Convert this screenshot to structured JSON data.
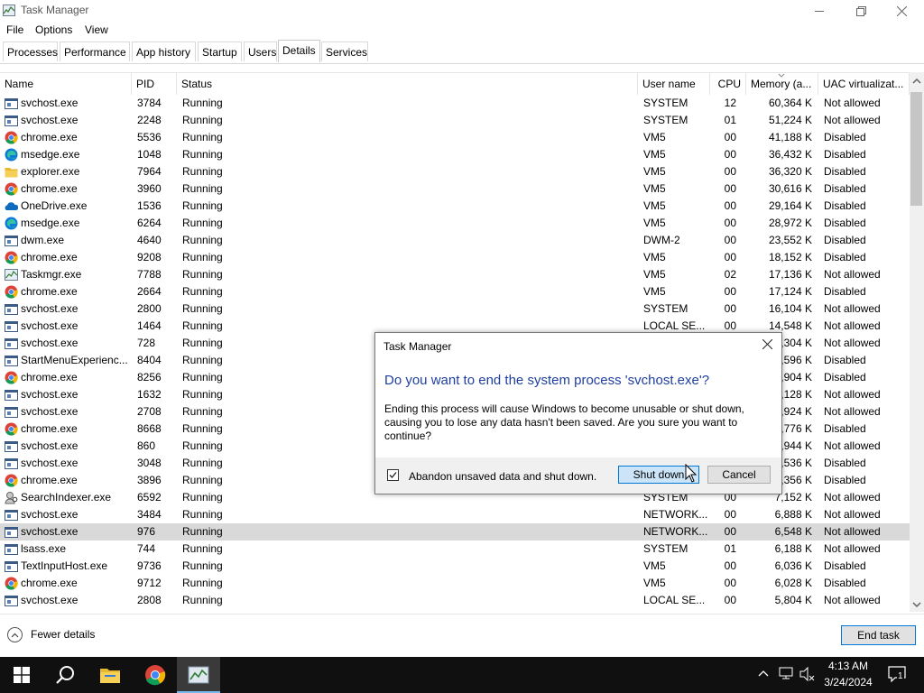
{
  "window": {
    "title": "Task Manager"
  },
  "menu": [
    "File",
    "Options",
    "View"
  ],
  "tabs": [
    "Processes",
    "Performance",
    "App history",
    "Startup",
    "Users",
    "Details",
    "Services"
  ],
  "active_tab": "Details",
  "columns": [
    "Name",
    "PID",
    "Status",
    "User name",
    "CPU",
    "Memory (a...",
    "UAC virtualizat..."
  ],
  "rows": [
    {
      "icon": "service-icon",
      "name": "svchost.exe",
      "pid": "3784",
      "status": "Running",
      "user": "SYSTEM",
      "cpu": "12",
      "mem": "60,364 K",
      "uac": "Not allowed"
    },
    {
      "icon": "service-icon",
      "name": "svchost.exe",
      "pid": "2248",
      "status": "Running",
      "user": "SYSTEM",
      "cpu": "01",
      "mem": "51,224 K",
      "uac": "Not allowed"
    },
    {
      "icon": "chrome-icon",
      "name": "chrome.exe",
      "pid": "5536",
      "status": "Running",
      "user": "VM5",
      "cpu": "00",
      "mem": "41,188 K",
      "uac": "Disabled"
    },
    {
      "icon": "edge-icon",
      "name": "msedge.exe",
      "pid": "1048",
      "status": "Running",
      "user": "VM5",
      "cpu": "00",
      "mem": "36,432 K",
      "uac": "Disabled"
    },
    {
      "icon": "explorer-icon",
      "name": "explorer.exe",
      "pid": "7964",
      "status": "Running",
      "user": "VM5",
      "cpu": "00",
      "mem": "36,320 K",
      "uac": "Disabled"
    },
    {
      "icon": "chrome-icon",
      "name": "chrome.exe",
      "pid": "3960",
      "status": "Running",
      "user": "VM5",
      "cpu": "00",
      "mem": "30,616 K",
      "uac": "Disabled"
    },
    {
      "icon": "onedrive-icon",
      "name": "OneDrive.exe",
      "pid": "1536",
      "status": "Running",
      "user": "VM5",
      "cpu": "00",
      "mem": "29,164 K",
      "uac": "Disabled"
    },
    {
      "icon": "edge-icon",
      "name": "msedge.exe",
      "pid": "6264",
      "status": "Running",
      "user": "VM5",
      "cpu": "00",
      "mem": "28,972 K",
      "uac": "Disabled"
    },
    {
      "icon": "service-icon",
      "name": "dwm.exe",
      "pid": "4640",
      "status": "Running",
      "user": "DWM-2",
      "cpu": "00",
      "mem": "23,552 K",
      "uac": "Disabled"
    },
    {
      "icon": "chrome-icon",
      "name": "chrome.exe",
      "pid": "9208",
      "status": "Running",
      "user": "VM5",
      "cpu": "00",
      "mem": "18,152 K",
      "uac": "Disabled"
    },
    {
      "icon": "taskmgr-icon",
      "name": "Taskmgr.exe",
      "pid": "7788",
      "status": "Running",
      "user": "VM5",
      "cpu": "02",
      "mem": "17,136 K",
      "uac": "Not allowed"
    },
    {
      "icon": "chrome-icon",
      "name": "chrome.exe",
      "pid": "2664",
      "status": "Running",
      "user": "VM5",
      "cpu": "00",
      "mem": "17,124 K",
      "uac": "Disabled"
    },
    {
      "icon": "service-icon",
      "name": "svchost.exe",
      "pid": "2800",
      "status": "Running",
      "user": "SYSTEM",
      "cpu": "00",
      "mem": "16,104 K",
      "uac": "Not allowed"
    },
    {
      "icon": "service-icon",
      "name": "svchost.exe",
      "pid": "1464",
      "status": "Running",
      "user": "LOCAL SE...",
      "cpu": "00",
      "mem": "14,548 K",
      "uac": "Not allowed"
    },
    {
      "icon": "service-icon",
      "name": "svchost.exe",
      "pid": "728",
      "status": "Running",
      "user": "",
      "cpu": "",
      "mem": "4,304 K",
      "uac": "Not allowed"
    },
    {
      "icon": "service-icon",
      "name": "StartMenuExperienc...",
      "pid": "8404",
      "status": "Running",
      "user": "",
      "cpu": "",
      "mem": "3,596 K",
      "uac": "Disabled"
    },
    {
      "icon": "chrome-icon",
      "name": "chrome.exe",
      "pid": "8256",
      "status": "Running",
      "user": "",
      "cpu": "",
      "mem": "0,904 K",
      "uac": "Disabled"
    },
    {
      "icon": "service-icon",
      "name": "svchost.exe",
      "pid": "1632",
      "status": "Running",
      "user": "",
      "cpu": "",
      "mem": "0,128 K",
      "uac": "Not allowed"
    },
    {
      "icon": "service-icon",
      "name": "svchost.exe",
      "pid": "2708",
      "status": "Running",
      "user": "",
      "cpu": "",
      "mem": "9,924 K",
      "uac": "Not allowed"
    },
    {
      "icon": "chrome-icon",
      "name": "chrome.exe",
      "pid": "8668",
      "status": "Running",
      "user": "",
      "cpu": "",
      "mem": "7,776 K",
      "uac": "Disabled"
    },
    {
      "icon": "service-icon",
      "name": "svchost.exe",
      "pid": "860",
      "status": "Running",
      "user": "",
      "cpu": "",
      "mem": "7,944 K",
      "uac": "Not allowed"
    },
    {
      "icon": "service-icon",
      "name": "svchost.exe",
      "pid": "3048",
      "status": "Running",
      "user": "",
      "cpu": "",
      "mem": "7,536 K",
      "uac": "Disabled"
    },
    {
      "icon": "chrome-icon",
      "name": "chrome.exe",
      "pid": "3896",
      "status": "Running",
      "user": "",
      "cpu": "",
      "mem": "7,356 K",
      "uac": "Disabled"
    },
    {
      "icon": "search-indexer-icon",
      "name": "SearchIndexer.exe",
      "pid": "6592",
      "status": "Running",
      "user": "SYSTEM",
      "cpu": "00",
      "mem": "7,152 K",
      "uac": "Not allowed"
    },
    {
      "icon": "service-icon",
      "name": "svchost.exe",
      "pid": "3484",
      "status": "Running",
      "user": "NETWORK...",
      "cpu": "00",
      "mem": "6,888 K",
      "uac": "Not allowed"
    },
    {
      "icon": "service-icon",
      "name": "svchost.exe",
      "pid": "976",
      "status": "Running",
      "user": "NETWORK...",
      "cpu": "00",
      "mem": "6,548 K",
      "uac": "Not allowed",
      "selected": true
    },
    {
      "icon": "service-icon",
      "name": "lsass.exe",
      "pid": "744",
      "status": "Running",
      "user": "SYSTEM",
      "cpu": "01",
      "mem": "6,188 K",
      "uac": "Not allowed"
    },
    {
      "icon": "service-icon",
      "name": "TextInputHost.exe",
      "pid": "9736",
      "status": "Running",
      "user": "VM5",
      "cpu": "00",
      "mem": "6,036 K",
      "uac": "Disabled"
    },
    {
      "icon": "chrome-icon",
      "name": "chrome.exe",
      "pid": "9712",
      "status": "Running",
      "user": "VM5",
      "cpu": "00",
      "mem": "6,028 K",
      "uac": "Disabled"
    },
    {
      "icon": "service-icon",
      "name": "svchost.exe",
      "pid": "2808",
      "status": "Running",
      "user": "LOCAL SE...",
      "cpu": "00",
      "mem": "5,804 K",
      "uac": "Not allowed"
    }
  ],
  "footer": {
    "fewer_details": "Fewer details",
    "end_task": "End task"
  },
  "dialog": {
    "title": "Task Manager",
    "heading": "Do you want to end the system process 'svchost.exe'?",
    "body": "Ending this process will cause Windows to become unusable or shut down, causing you to lose any data hasn't been saved. Are you sure you want to continue?",
    "checkbox_label": "Abandon unsaved data and shut down.",
    "checkbox_checked": true,
    "primary_button": "Shut down",
    "cancel_button": "Cancel"
  },
  "taskbar": {
    "time": "4:13 AM",
    "date": "3/24/2024",
    "notification_count": "1"
  },
  "colors": {
    "accent": "#0078d7",
    "selected_row": "#d9d9d9",
    "taskbar": "#101010",
    "dialog_heading": "#1f3fa0"
  }
}
